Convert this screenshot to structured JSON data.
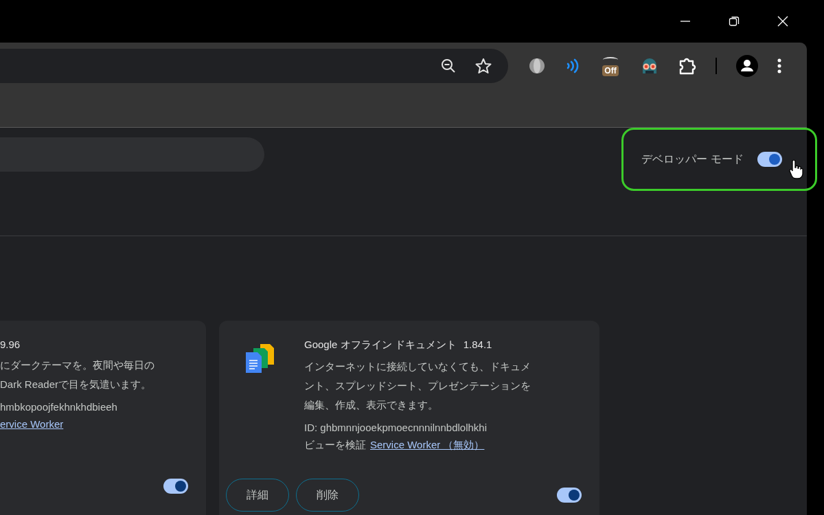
{
  "toolbar": {
    "off_badge": "Off"
  },
  "developer_mode": {
    "label": "デベロッパー モード",
    "on": true
  },
  "extensions": [
    {
      "version": "9.96",
      "description_lines": [
        "にダークテーマを。夜間や毎日の",
        "Dark Readerで目を気遣います。"
      ],
      "id": "hmbkopoojfekhnkhdbieeh",
      "link": "ervice Worker",
      "enabled": true
    },
    {
      "name": "Google オフライン ドキュメント",
      "version": "1.84.1",
      "description_lines": [
        "インターネットに接続していなくても、ドキュメ",
        "ント、スプレッドシート、プレゼンテーションを",
        "編集、作成、表示できます。"
      ],
      "id": "ID: ghbmnnjooekpmoecnnnilnnbdlolhkhi",
      "inspect_label": "ビューを検証",
      "link": "Service Worker （無効）",
      "enabled": true,
      "buttons": [
        "詳細",
        "削除"
      ]
    }
  ]
}
